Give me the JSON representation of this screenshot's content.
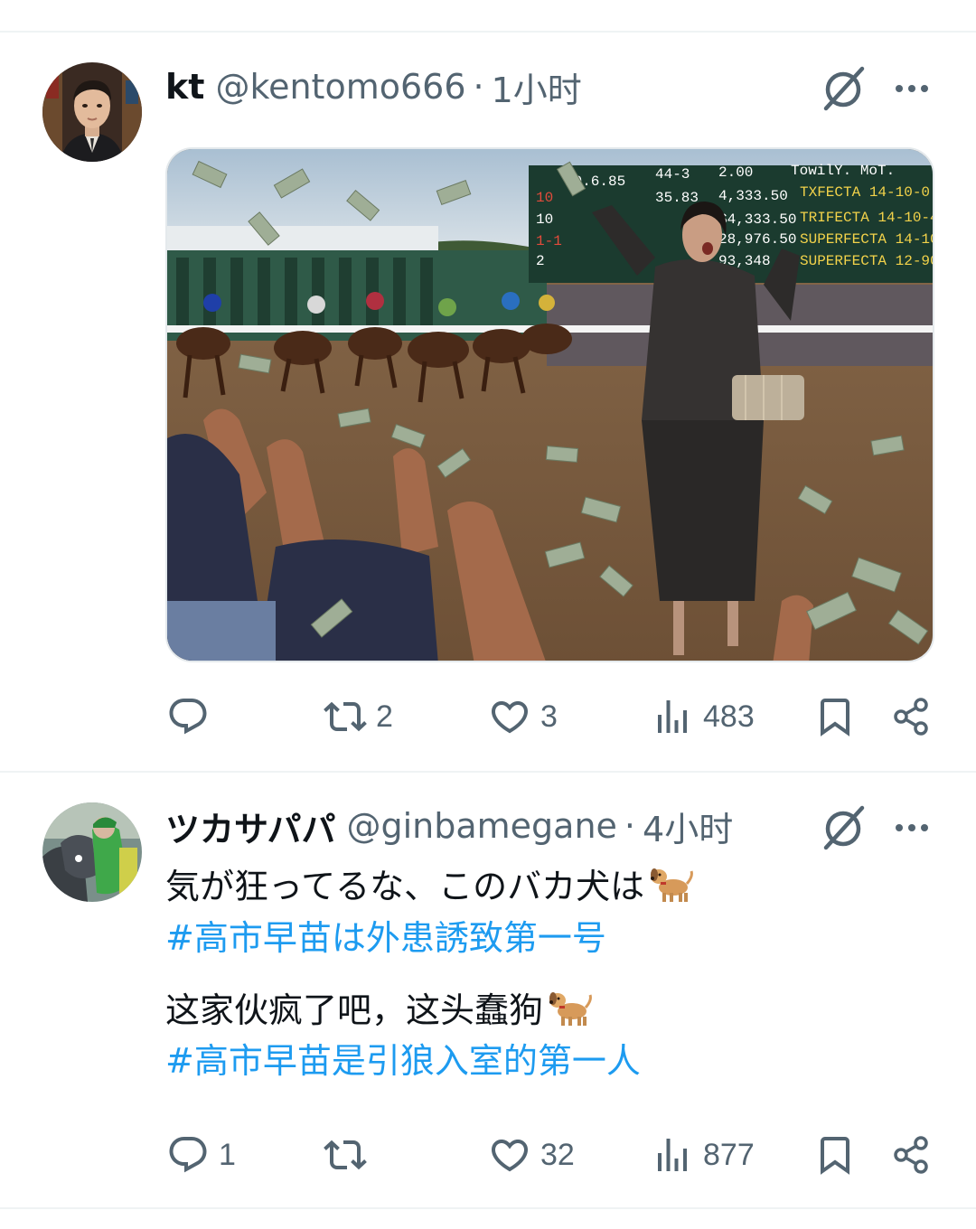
{
  "tweets": [
    {
      "name": "kt",
      "handle": "@kentomo666",
      "separator": "·",
      "time": "1小时",
      "avatar_icon": "avatar-man-suit",
      "media_icon": "horse-race-photo",
      "stats": {
        "reply": "",
        "retweet": "2",
        "like": "3",
        "views": "483"
      }
    },
    {
      "name": "ツカサパパ",
      "handle": "@ginbamegane",
      "separator": "·",
      "time": "4小时",
      "avatar_icon": "avatar-jockey-horse",
      "text_jp": "気が狂ってるな、このバカ犬は",
      "hashtag_jp": "#高市早苗は外患誘致第一号",
      "text_cn": "这家伙疯了吧，这头蠢狗",
      "hashtag_cn": "#高市早苗是引狼入室的第一人",
      "emoji_icon": "dog-emoji",
      "stats": {
        "reply": "1",
        "retweet": "",
        "like": "32",
        "views": "877"
      }
    }
  ],
  "colors": {
    "text": "#0f1419",
    "secondary": "#536471",
    "link": "#1d9bf0",
    "divider": "#eff3f4"
  }
}
